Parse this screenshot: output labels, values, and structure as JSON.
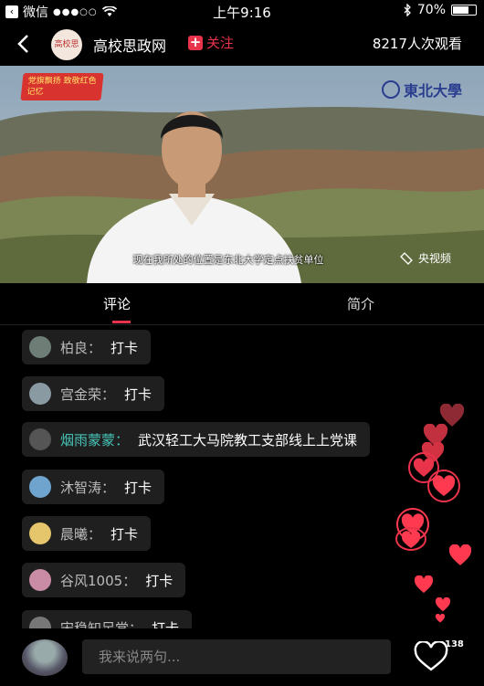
{
  "status_bar": {
    "carrier": "微信",
    "signal": "●●●○○",
    "time": "上午9:16",
    "battery": "70%",
    "battery_level": 0.7
  },
  "header": {
    "channel_name": "高校思政网",
    "follow_label": "关注",
    "viewers": "8217人次观看",
    "logo_text": "高校思政"
  },
  "video": {
    "badge_text": "党旗飘扬 致敬红色记忆",
    "school_logo": "東北大學",
    "subtitle": "现在我所处的位置是东北大学定点扶贫单位",
    "source": "央视频"
  },
  "tabs": [
    {
      "label": "评论"
    },
    {
      "label": "简介"
    }
  ],
  "comments": [
    {
      "name": "柏良",
      "text": "打卡",
      "highlight": false,
      "avatar_color": "#6f7d77"
    },
    {
      "name": "宫金荣",
      "text": "打卡",
      "highlight": false,
      "avatar_color": "#8a9aa3"
    },
    {
      "name": "烟雨蒙蒙",
      "text": "武汉轻工大马院教工支部线上上党课",
      "highlight": true,
      "avatar_color": "#555555"
    },
    {
      "name": "沐智涛",
      "text": "打卡",
      "highlight": false,
      "avatar_color": "#6fa4cf"
    },
    {
      "name": "晨曦",
      "text": "打卡",
      "highlight": false,
      "avatar_color": "#e5c66c"
    },
    {
      "name": "谷风1005",
      "text": "打卡",
      "highlight": false,
      "avatar_color": "#c98ca4"
    },
    {
      "name": "宋稳知足常",
      "text": "打卡",
      "highlight": false,
      "avatar_color": "#777777"
    }
  ],
  "comment_separator": "：",
  "bottom": {
    "input_placeholder": "我来说两句...",
    "like_count": "138"
  },
  "colors": {
    "accent": "#e8334a",
    "highlight_name": "#46c4b6",
    "heart": "#ff5866"
  }
}
